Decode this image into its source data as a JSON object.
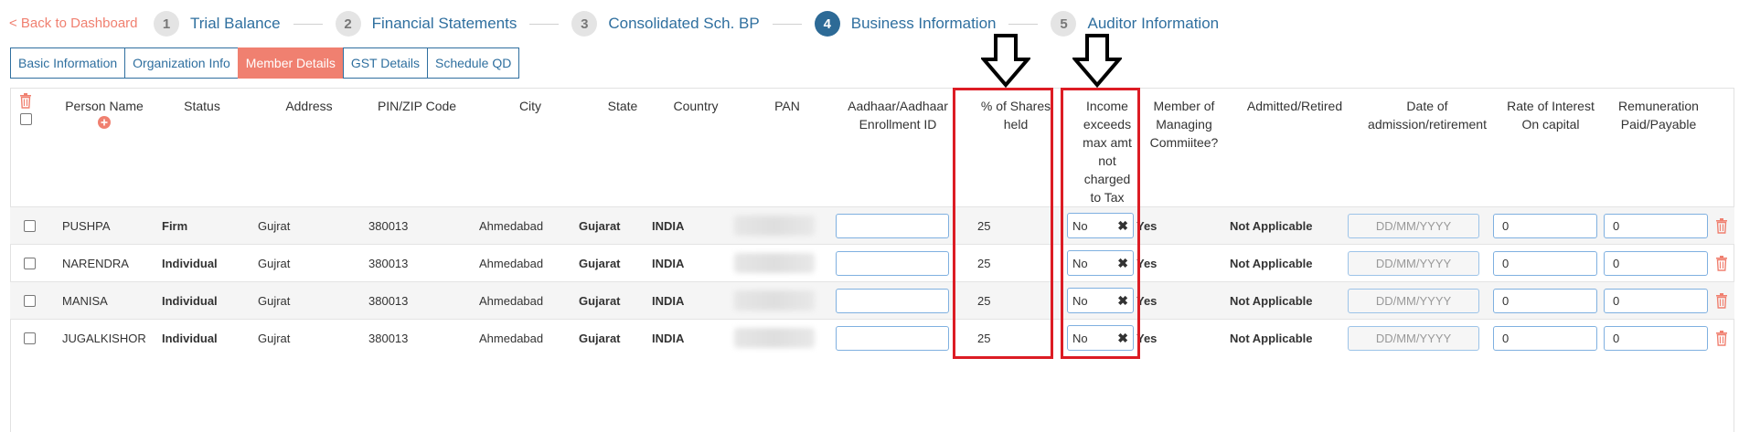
{
  "nav": {
    "back_label": "< Back to Dashboard",
    "steps": [
      {
        "num": "1",
        "label": "Trial Balance",
        "active": false
      },
      {
        "num": "2",
        "label": "Financial Statements",
        "active": false
      },
      {
        "num": "3",
        "label": "Consolidated Sch. BP",
        "active": false
      },
      {
        "num": "4",
        "label": "Business Information",
        "active": true
      },
      {
        "num": "5",
        "label": "Auditor Information",
        "active": false
      }
    ]
  },
  "tabs": [
    {
      "label": "Basic Information",
      "active": false
    },
    {
      "label": "Organization Info",
      "active": false
    },
    {
      "label": "Member Details",
      "active": true
    },
    {
      "label": "GST Details",
      "active": false
    },
    {
      "label": "Schedule QD",
      "active": false
    }
  ],
  "table": {
    "headers": {
      "person_name": "Person Name",
      "status": "Status",
      "address": "Address",
      "pin": "PIN/ZIP Code",
      "city": "City",
      "state": "State",
      "country": "Country",
      "pan": "PAN",
      "aadhaar_1": "Aadhaar/Aadhaar",
      "aadhaar_2": "Enrollment ID",
      "shares_1": "% of Shares",
      "shares_2": "held",
      "income_1": "Income",
      "income_2": "exceeds",
      "income_3": "max amt",
      "income_4": "not",
      "income_5": "charged",
      "income_6": "to Tax",
      "member_1": "Member of",
      "member_2": "Managing",
      "member_3": "Commiitee?",
      "admitted": "Admitted/Retired",
      "date_1": "Date of",
      "date_2": "admission/retirement",
      "rate_1": "Rate of Interest",
      "rate_2": "On capital",
      "rem_1": "Remuneration",
      "rem_2": "Paid/Payable"
    },
    "date_placeholder": "DD/MM/YYYY",
    "rows": [
      {
        "name": "PUSHPA",
        "status": "Firm",
        "address": "Gujrat",
        "pin": "380013",
        "city": "Ahmedabad",
        "state": "Gujarat",
        "country": "INDIA",
        "aadhaar": "",
        "shares": "25",
        "income": "No",
        "member": "Yes",
        "admitted": "Not Applicable",
        "date": "",
        "rate": "0",
        "remuneration": "0"
      },
      {
        "name": "NARENDRA",
        "status": "Individual",
        "address": "Gujrat",
        "pin": "380013",
        "city": "Ahmedabad",
        "state": "Gujarat",
        "country": "INDIA",
        "aadhaar": "",
        "shares": "25",
        "income": "No",
        "member": "Yes",
        "admitted": "Not Applicable",
        "date": "",
        "rate": "0",
        "remuneration": "0"
      },
      {
        "name": "MANISA",
        "status": "Individual",
        "address": "Gujrat",
        "pin": "380013",
        "city": "Ahmedabad",
        "state": "Gujarat",
        "country": "INDIA",
        "aadhaar": "",
        "shares": "25",
        "income": "No",
        "member": "Yes",
        "admitted": "Not Applicable",
        "date": "",
        "rate": "0",
        "remuneration": "0"
      },
      {
        "name": "JUGALKISHOR",
        "status": "Individual",
        "address": "Gujrat",
        "pin": "380013",
        "city": "Ahmedabad",
        "state": "Gujarat",
        "country": "INDIA",
        "aadhaar": "",
        "shares": "25",
        "income": "No",
        "member": "Yes",
        "admitted": "Not Applicable",
        "date": "",
        "rate": "0",
        "remuneration": "0"
      }
    ]
  },
  "colors": {
    "accent": "#2f6f9f",
    "active_tab": "#f08070",
    "highlight_box": "#dc1c24"
  }
}
